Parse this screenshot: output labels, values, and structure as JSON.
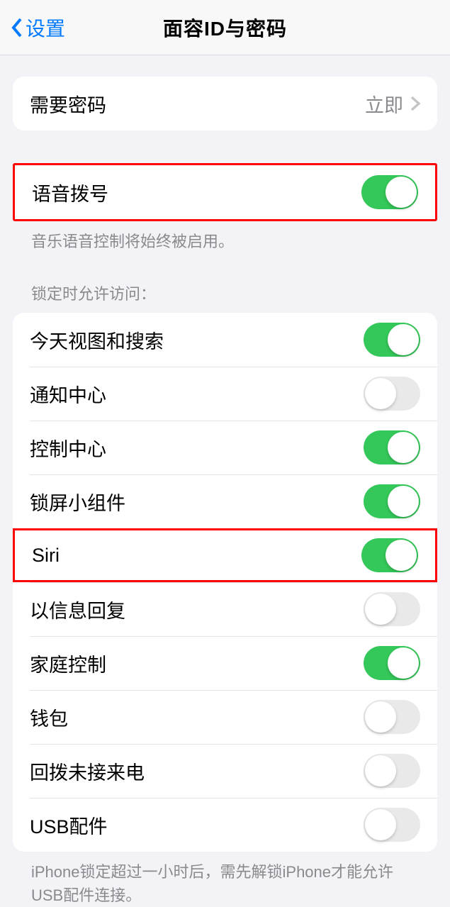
{
  "nav": {
    "back_label": "设置",
    "title": "面容ID与密码"
  },
  "section_require": {
    "label": "需要密码",
    "value": "立即"
  },
  "section_voice": {
    "label": "语音拨号",
    "on": true,
    "footer": "音乐语音控制将始终被启用。"
  },
  "section_lock": {
    "header": "锁定时允许访问：",
    "items": [
      {
        "label": "今天视图和搜索",
        "on": true
      },
      {
        "label": "通知中心",
        "on": false
      },
      {
        "label": "控制中心",
        "on": true
      },
      {
        "label": "锁屏小组件",
        "on": true
      },
      {
        "label": "Siri",
        "on": true,
        "highlight": true
      },
      {
        "label": "以信息回复",
        "on": false
      },
      {
        "label": "家庭控制",
        "on": true
      },
      {
        "label": "钱包",
        "on": false
      },
      {
        "label": "回拨未接来电",
        "on": false
      },
      {
        "label": "USB配件",
        "on": false
      }
    ],
    "footer": "iPhone锁定超过一小时后，需先解锁iPhone才能允许USB配件连接。"
  }
}
